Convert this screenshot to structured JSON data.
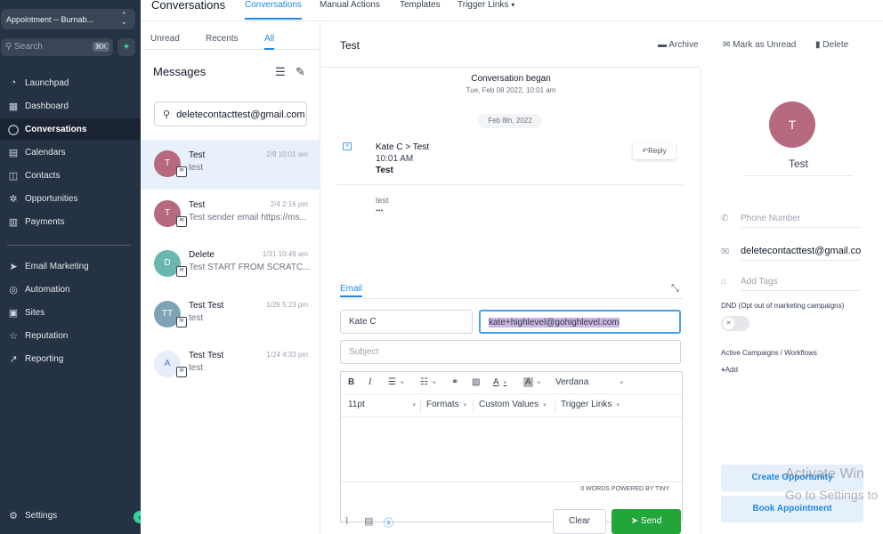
{
  "sidebar": {
    "account": "Appointment -- Burnab...",
    "search_placeholder": "Search",
    "search_shortcut": "⌘K",
    "nav": [
      {
        "label": "Launchpad",
        "icon": "rocket-icon"
      },
      {
        "label": "Dashboard",
        "icon": "grid-icon"
      },
      {
        "label": "Conversations",
        "icon": "chat-icon"
      },
      {
        "label": "Calendars",
        "icon": "calendar-icon"
      },
      {
        "label": "Contacts",
        "icon": "contacts-icon"
      },
      {
        "label": "Opportunities",
        "icon": "opportunities-icon"
      },
      {
        "label": "Payments",
        "icon": "payments-icon"
      },
      {
        "label": "Email Marketing",
        "icon": "send-icon"
      },
      {
        "label": "Automation",
        "icon": "automation-icon"
      },
      {
        "label": "Sites",
        "icon": "sites-icon"
      },
      {
        "label": "Reputation",
        "icon": "star-icon"
      },
      {
        "label": "Reporting",
        "icon": "trend-icon"
      }
    ],
    "settings": "Settings"
  },
  "topnav": {
    "title": "Conversations",
    "tabs": [
      "Conversations",
      "Manual Actions",
      "Templates",
      "Trigger Links"
    ]
  },
  "list": {
    "filters": [
      "Unread",
      "Recents",
      "All"
    ],
    "heading": "Messages",
    "search_value": "deletecontacttest@gmail.com",
    "conversations": [
      {
        "initials": "T",
        "name": "Test",
        "preview": "test",
        "date": "2/8 10:01 am",
        "color": "#b7697f"
      },
      {
        "initials": "T",
        "name": "Test",
        "preview": "Test sender email https://ms...",
        "date": "2/4 2:16 pm",
        "color": "#b7697f"
      },
      {
        "initials": "D",
        "name": "Delete",
        "preview": "Test START FROM SCRATC...",
        "date": "1/31 10:49 am",
        "color": "#6ab7b0"
      },
      {
        "initials": "TT",
        "name": "Test Test",
        "preview": "test",
        "date": "1/26 5:23 pm",
        "color": "#7fa3b5"
      },
      {
        "initials": "A",
        "name": "Test Test",
        "preview": "test",
        "date": "1/24 4:33 pm",
        "color": "#e8eef8"
      }
    ]
  },
  "main": {
    "title": "Test",
    "actions": [
      "Archive",
      "Mark as Unread",
      "Delete"
    ],
    "began": "Conversation began",
    "began_date": "Tue, Feb 08 2022, 10:01 am",
    "date_pill": "Feb 8th, 2022",
    "email": {
      "from": "Kate C > Test",
      "time": "10:01 AM",
      "subject": "Test",
      "body": "test",
      "more": "•••",
      "reply": "Reply"
    },
    "compose": {
      "tab": "Email",
      "from_name": "Kate C",
      "to": "kate+highlevel@gohighlevel.com",
      "subject_placeholder": "Subject",
      "font": "Verdana",
      "size": "11pt",
      "formats": "Formats",
      "custom_values": "Custom Values",
      "trigger_links": "Trigger Links",
      "word_count": "0 WORDS POWERED BY TINY",
      "clear": "Clear",
      "send": "Send"
    }
  },
  "right": {
    "initial": "T",
    "name": "Test",
    "phone_placeholder": "Phone Number",
    "email": "deletecontacttest@gmail.com",
    "tags_placeholder": "Add Tags",
    "dnd_label": "DND (Opt out of marketing campaigns)",
    "campaigns_label": "Active Campaigns / Workflows",
    "add": "Add",
    "create_opportunity": "Create Opportunity",
    "book_appointment": "Book Appointment"
  },
  "watermark": {
    "line1": "Activate Win",
    "line2": "Go to Settings to"
  }
}
